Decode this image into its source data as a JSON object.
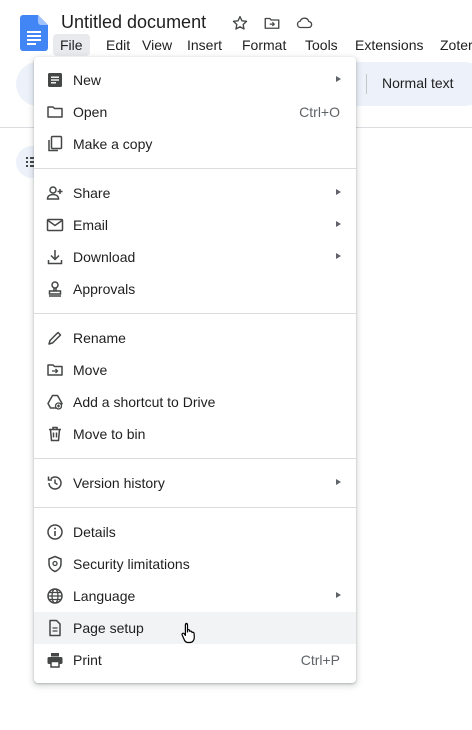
{
  "document": {
    "title": "Untitled document"
  },
  "menubar": {
    "items": [
      "File",
      "Edit",
      "View",
      "Insert",
      "Format",
      "Tools",
      "Extensions",
      "Zoter"
    ],
    "active": "File"
  },
  "toolbar": {
    "paragraph_style": "Normal text"
  },
  "file_menu": {
    "groups": [
      [
        {
          "label": "New",
          "icon": "document-icon",
          "submenu": true
        },
        {
          "label": "Open",
          "icon": "folder-icon",
          "shortcut": "Ctrl+O"
        },
        {
          "label": "Make a copy",
          "icon": "copy-icon"
        }
      ],
      [
        {
          "label": "Share",
          "icon": "person-add-icon",
          "submenu": true
        },
        {
          "label": "Email",
          "icon": "mail-icon",
          "submenu": true
        },
        {
          "label": "Download",
          "icon": "download-icon",
          "submenu": true
        },
        {
          "label": "Approvals",
          "icon": "stamp-icon"
        }
      ],
      [
        {
          "label": "Rename",
          "icon": "pencil-icon"
        },
        {
          "label": "Move",
          "icon": "move-folder-icon"
        },
        {
          "label": "Add a shortcut to Drive",
          "icon": "drive-shortcut-icon"
        },
        {
          "label": "Move to bin",
          "icon": "trash-icon"
        }
      ],
      [
        {
          "label": "Version history",
          "icon": "history-icon",
          "submenu": true
        }
      ],
      [
        {
          "label": "Details",
          "icon": "info-icon"
        },
        {
          "label": "Security limitations",
          "icon": "shield-icon"
        },
        {
          "label": "Language",
          "icon": "globe-icon",
          "submenu": true
        },
        {
          "label": "Page setup",
          "icon": "page-icon",
          "hover": true
        },
        {
          "label": "Print",
          "icon": "printer-icon",
          "shortcut": "Ctrl+P"
        }
      ]
    ]
  }
}
